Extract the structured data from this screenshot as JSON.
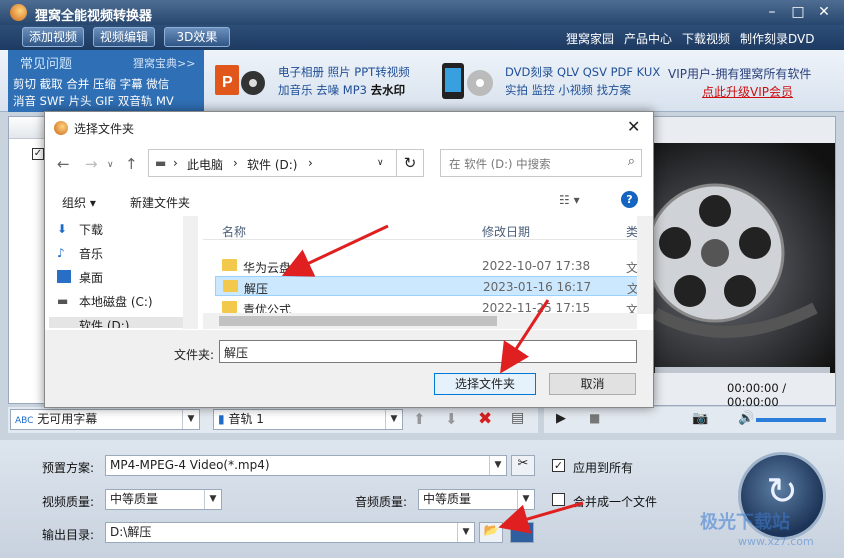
{
  "window": {
    "title": "狸窝全能视频转换器"
  },
  "menubar": {
    "buttons": [
      "添加视频",
      "视频编辑",
      "3D效果"
    ],
    "links": [
      "狸窝家园",
      "产品中心",
      "下载视频",
      "制作刻录DVD"
    ]
  },
  "adbar": {
    "faq_title": "常见问题",
    "faq_more": "狸窝宝典>>",
    "faq_row1": "剪切 截取 合并 压缩 字幕 微信",
    "faq_row2": "消音 SWF 片头 GIF 双音轨 MV",
    "ppt_row1": "电子相册 照片 PPT转视频",
    "ppt_row2a": "加音乐 去噪 MP3",
    "ppt_row2b": "去水印",
    "dvd_row1": "DVD刻录 QLV QSV PDF KUX",
    "dvd_row2": "实拍 监控 小视频 找方案",
    "vip_text": "VIP用户-拥有狸窝所有软件",
    "vip_link": "点此升级VIP会员"
  },
  "preview": {
    "time": "00:00:00 / 00:00:00",
    "progress": 0
  },
  "subtitle_combo": "无可用字幕",
  "audio_combo": "音轨 1",
  "settings": {
    "preset_label": "预置方案:",
    "preset_value": "MP4-MPEG-4 Video(*.mp4)",
    "apply_all": "应用到所有",
    "video_quality_label": "视频质量:",
    "video_quality": "中等质量",
    "audio_quality_label": "音频质量:",
    "audio_quality": "中等质量",
    "merge_label": "合并成一个文件",
    "output_label": "输出目录:",
    "output_value": "D:\\解压"
  },
  "dialog": {
    "title": "选择文件夹",
    "path": [
      "此电脑",
      "软件 (D:)"
    ],
    "search_placeholder": "在 软件 (D:) 中搜索",
    "organize": "组织",
    "new_folder": "新建文件夹",
    "nav_items": [
      "下载",
      "音乐",
      "桌面",
      "本地磁盘 (C:)",
      "软件 (D:)"
    ],
    "col_name": "名称",
    "col_date": "修改日期",
    "col_type": "类",
    "files": [
      {
        "name": "华为云盘",
        "date": "2022-10-07 17:38",
        "type": "文"
      },
      {
        "name": "解压",
        "date": "2023-01-16 16:17",
        "type": "文"
      },
      {
        "name": "青优公式",
        "date": "2022-11-25 17:15",
        "type": "文"
      }
    ],
    "folder_label": "文件夹:",
    "folder_value": "解压",
    "select_button": "选择文件夹",
    "cancel_button": "取消"
  },
  "watermark": {
    "line1": "极光下载站",
    "line2": "www.xz7.com"
  },
  "colors": {
    "title_bar": "#27476f",
    "accent": "#0078d7",
    "arrow_red": "#e02020",
    "vip_link": "#cc1010"
  }
}
